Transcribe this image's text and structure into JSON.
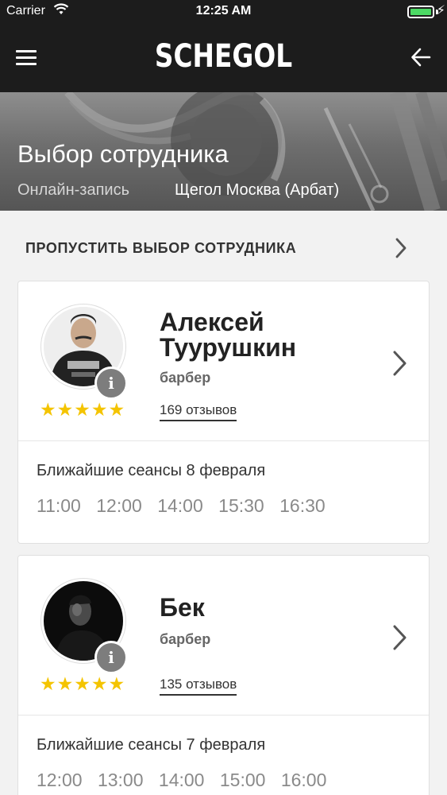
{
  "status_bar": {
    "carrier": "Carrier",
    "time": "12:25 AM",
    "battery_color": "#4cd964"
  },
  "nav": {
    "brand": "SCHEGOL",
    "menu_icon": "hamburger-menu-icon",
    "back_icon": "arrow-left-icon"
  },
  "hero": {
    "title": "Выбор сотрудника",
    "subtitle_left": "Онлайн-запись",
    "subtitle_right": "Щегол Москва (Арбат)"
  },
  "skip": {
    "label": "ПРОПУСТИТЬ ВЫБОР СОТРУДНИКА"
  },
  "staff": [
    {
      "name_line1": "Алексей",
      "name_line2": "Туурушкин",
      "role": "барбер",
      "rating": 5,
      "stars": "★★★★★",
      "reviews": "169 отзывов",
      "info_label": "i",
      "sessions_title": "Ближайшие сеансы 8 февраля",
      "slots": [
        "11:00",
        "12:00",
        "14:00",
        "15:30",
        "16:30"
      ]
    },
    {
      "name_line1": "Бек",
      "name_line2": "",
      "role": "барбер",
      "rating": 5,
      "stars": "★★★★★",
      "reviews": "135 отзывов",
      "info_label": "i",
      "sessions_title": "Ближайшие сеансы 7 февраля",
      "slots": [
        "12:00",
        "13:00",
        "14:00",
        "15:00",
        "16:00"
      ]
    }
  ],
  "colors": {
    "header_bg": "#1c1c1c",
    "star": "#f4c400",
    "info_badge": "#7d7d7d"
  }
}
